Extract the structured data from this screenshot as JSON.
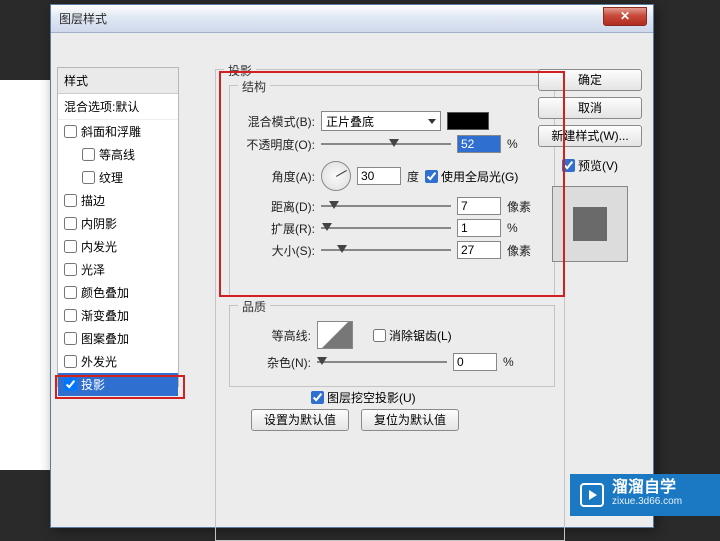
{
  "window": {
    "title": "图层样式"
  },
  "styles_panel": {
    "header": "样式",
    "blend_options": "混合选项:默认",
    "items": [
      {
        "label": "斜面和浮雕",
        "checked": false
      },
      {
        "label": "等高线",
        "checked": false,
        "sub": true
      },
      {
        "label": "纹理",
        "checked": false,
        "sub": true
      },
      {
        "label": "描边",
        "checked": false
      },
      {
        "label": "内阴影",
        "checked": false
      },
      {
        "label": "内发光",
        "checked": false
      },
      {
        "label": "光泽",
        "checked": false
      },
      {
        "label": "颜色叠加",
        "checked": false
      },
      {
        "label": "渐变叠加",
        "checked": false
      },
      {
        "label": "图案叠加",
        "checked": false
      },
      {
        "label": "外发光",
        "checked": false
      },
      {
        "label": "投影",
        "checked": true,
        "selected": true
      }
    ]
  },
  "projection": {
    "legend": "投影"
  },
  "structure": {
    "legend": "结构",
    "blend_mode_label": "混合模式(B):",
    "blend_mode_value": "正片叠底",
    "opacity_label": "不透明度(O):",
    "opacity_value": "52",
    "opacity_unit": "%",
    "angle_label": "角度(A):",
    "angle_value": "30",
    "angle_unit": "度",
    "global_light": "使用全局光(G)",
    "distance_label": "距离(D):",
    "distance_value": "7",
    "distance_unit": "像素",
    "spread_label": "扩展(R):",
    "spread_value": "1",
    "spread_unit": "%",
    "size_label": "大小(S):",
    "size_value": "27",
    "size_unit": "像素"
  },
  "quality": {
    "legend": "品质",
    "contour_label": "等高线:",
    "antialias": "消除锯齿(L)",
    "noise_label": "杂色(N):",
    "noise_value": "0",
    "noise_unit": "%"
  },
  "knockout": {
    "label": "图层挖空投影(U)"
  },
  "buttons": {
    "make_default": "设置为默认值",
    "reset_default": "复位为默认值",
    "ok": "确定",
    "cancel": "取消",
    "new_style": "新建样式(W)...",
    "preview": "预览(V)"
  },
  "watermark": {
    "brand": "溜溜自学",
    "url": "zixue.3d66.com"
  }
}
